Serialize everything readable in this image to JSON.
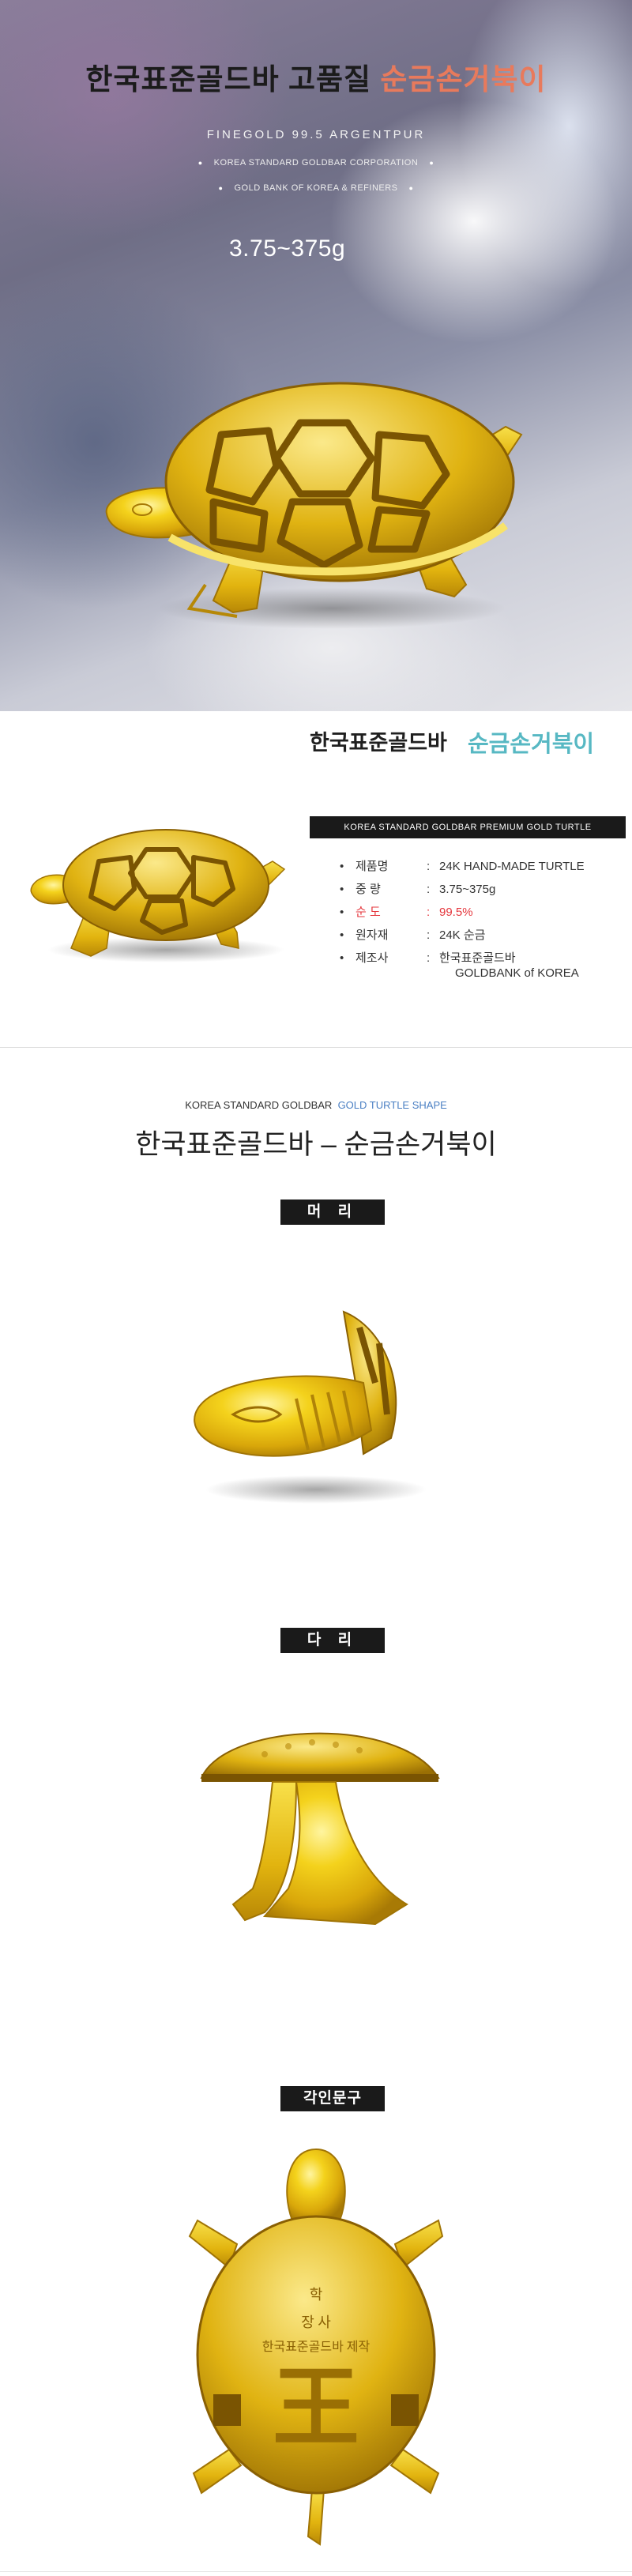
{
  "hero": {
    "title_main": "한국표준골드바  고품질",
    "title_accent": "순금손거북이",
    "subtitle": "FINEGOLD 99.5 ARGENTPUR",
    "corporation": "KOREA STANDARD GOLDBAR CORPORATION",
    "bank": "GOLD BANK OF KOREA & REFINERS",
    "weight_range": "3.75~375g"
  },
  "info": {
    "brand": "한국표준골드바",
    "product_name": "순금손거북이",
    "bar_text": "KOREA STANDARD GOLDBAR PREMIUM GOLD TURTLE",
    "specs": [
      {
        "label": "제품명",
        "value": "24K HAND-MADE TURTLE"
      },
      {
        "label": "중   량",
        "value": "3.75~375g"
      },
      {
        "label": "순   도",
        "value": "99.5%"
      },
      {
        "label": "원자재",
        "value": "24K 순금"
      },
      {
        "label": "제조사",
        "value": "한국표준골드바"
      }
    ],
    "maker_extra": "GOLDBANK of KOREA"
  },
  "shape": {
    "en_prefix": "KOREA STANDARD GOLDBAR",
    "en_accent": "GOLD TURTLE SHAPE",
    "title": "한국표준골드바 – 순금손거북이",
    "tags": [
      "머 리",
      "다 리",
      "각인문구"
    ]
  },
  "engraving": {
    "top_char": "학",
    "line1": "장  사",
    "line2": "한국표준골드바 제작",
    "center_glyph": "王"
  },
  "colors": {
    "accent_title": "#e87a5c",
    "accent_name": "#57b8c3",
    "accent_purity": "#e5373d",
    "accent_en": "#4a7fc3",
    "gold": "#f0c418"
  }
}
